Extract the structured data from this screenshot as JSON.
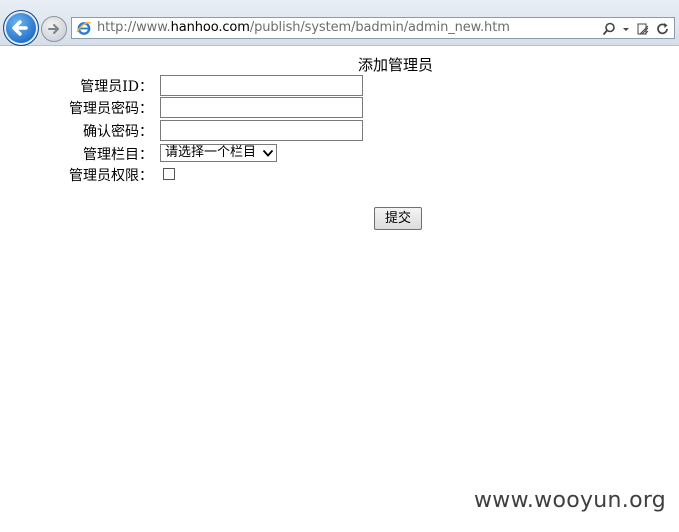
{
  "browser": {
    "url_prefix": "http://www.",
    "url_domain": "hanhoo.com",
    "url_path": "/publish/system/badmin/admin_new.htm"
  },
  "form": {
    "title": "添加管理员",
    "fields": {
      "admin_id_label": "管理员ID：",
      "password_label": "管理员密码：",
      "confirm_password_label": "确认密码：",
      "column_label": "管理栏目：",
      "column_select_value": "请选择一个栏目",
      "permission_label": "管理员权限："
    },
    "submit_label": "提交"
  },
  "watermark": "www.wooyun.org"
}
